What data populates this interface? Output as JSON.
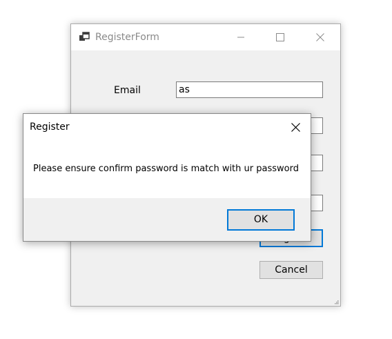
{
  "window": {
    "title": "RegisterForm",
    "fields": {
      "email_label": "Email",
      "email_value": "as"
    },
    "buttons": {
      "register_label": "Register",
      "cancel_label": "Cancel"
    }
  },
  "messagebox": {
    "title": "Register",
    "message": "Please ensure confirm password is match with ur password",
    "ok_label": "OK"
  },
  "colors": {
    "accent": "#0078d7",
    "form_background": "#f0f0f0",
    "button_face": "#e1e1e1"
  },
  "icons": {
    "app": "winforms-app-icon",
    "minimize": "minimize-icon",
    "maximize": "maximize-icon",
    "close": "close-icon"
  }
}
